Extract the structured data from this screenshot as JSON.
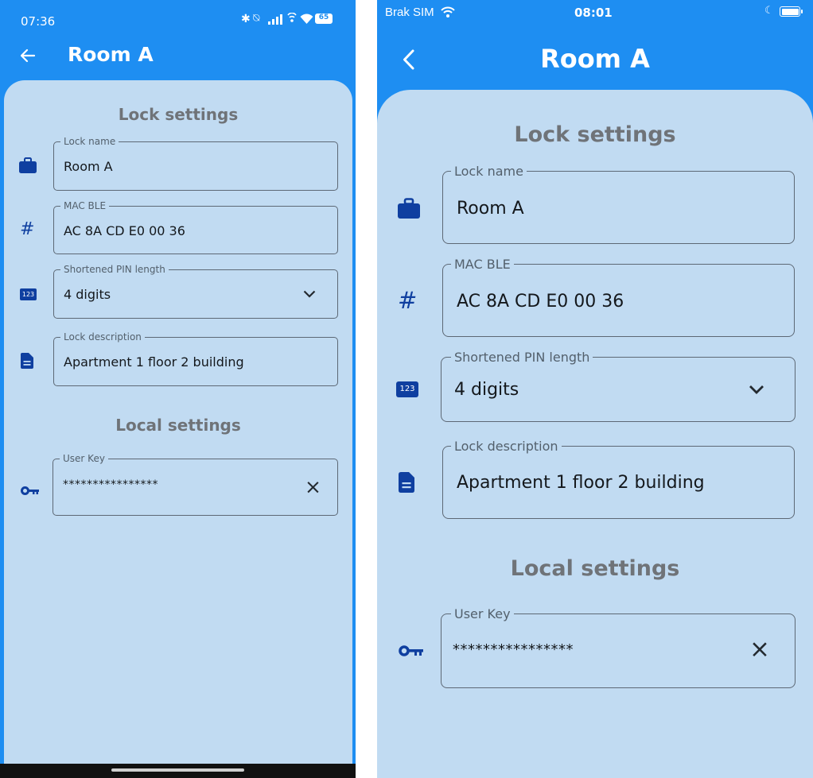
{
  "colors": {
    "primary": "#1e8ef2",
    "card": "#c1dbf2",
    "icon": "#0f3fa0"
  },
  "android": {
    "status_time": "07:36",
    "battery": "65",
    "title": "Room A",
    "sections": {
      "lock": "Lock settings",
      "local": "Local settings"
    },
    "fields": {
      "lock_name": {
        "label": "Lock name",
        "value": "Room A"
      },
      "mac": {
        "label": "MAC BLE",
        "value": "AC 8A CD E0 00 36"
      },
      "pin": {
        "label": "Shortened PIN length",
        "value": "4 digits"
      },
      "description": {
        "label": "Lock description",
        "value": "Apartment 1 floor 2 building"
      },
      "user_key": {
        "label": "User Key",
        "value": "****************"
      }
    },
    "icons": {
      "hash": "#",
      "pin_badge": "123",
      "clear": "×"
    }
  },
  "ios": {
    "carrier": "Brak SIM",
    "status_time": "08:01",
    "title": "Room A",
    "sections": {
      "lock": "Lock settings",
      "local": "Local settings"
    },
    "fields": {
      "lock_name": {
        "label": "Lock name",
        "value": "Room A"
      },
      "mac": {
        "label": "MAC BLE",
        "value": "AC 8A CD E0 00 36"
      },
      "pin": {
        "label": "Shortened PIN length",
        "value": "4 digits"
      },
      "description": {
        "label": "Lock description",
        "value": "Apartment 1 floor 2 building"
      },
      "user_key": {
        "label": "User Key",
        "value": "****************"
      }
    },
    "icons": {
      "hash": "#",
      "pin_badge": "123",
      "clear": "×"
    }
  }
}
